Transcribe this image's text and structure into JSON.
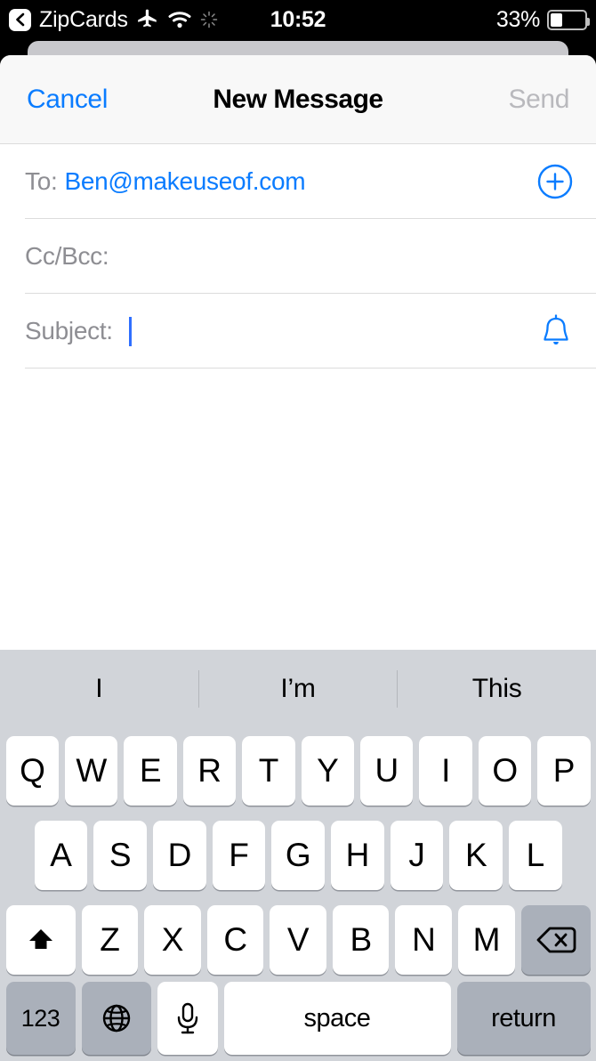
{
  "status_bar": {
    "back_icon": "chevron-left-icon",
    "app_name": "ZipCards",
    "airplane_icon": "airplane-mode-icon",
    "wifi_icon": "wifi-icon",
    "activity_icon": "activity-spinner-icon",
    "time": "10:52",
    "battery_percent": "33%",
    "battery_level": 33
  },
  "nav_bar": {
    "cancel_label": "Cancel",
    "title": "New Message",
    "send_label": "Send",
    "cancel_color": "#0a7cff",
    "send_color": "#b9b9bd"
  },
  "fields": [
    {
      "label": "To:",
      "value": "Ben@makeuseof.com",
      "action_icon": "add-contact-plus-circle-icon",
      "caret": false
    },
    {
      "label": "Cc/Bcc:",
      "value": "",
      "action_icon": "",
      "caret": false
    },
    {
      "label": "Subject:",
      "value": "",
      "action_icon": "notify-bell-icon",
      "caret": true
    }
  ],
  "body": {
    "text": ""
  },
  "keyboard": {
    "predictions": [
      "I",
      "I’m",
      "This"
    ],
    "row1": [
      "Q",
      "W",
      "E",
      "R",
      "T",
      "Y",
      "U",
      "I",
      "O",
      "P"
    ],
    "row2": [
      "A",
      "S",
      "D",
      "F",
      "G",
      "H",
      "J",
      "K",
      "L"
    ],
    "row3_letters": [
      "Z",
      "X",
      "C",
      "V",
      "B",
      "N",
      "M"
    ],
    "shift_icon": "shift-up-arrow-icon",
    "backspace_icon": "backspace-delete-icon",
    "numbers_label": "123",
    "globe_icon": "globe-language-icon",
    "mic_icon": "microphone-icon",
    "space_label": "space",
    "return_label": "return"
  },
  "colors": {
    "accent_blue": "#0a7cff",
    "keyboard_bg": "#d1d4d9",
    "key_white": "#ffffff",
    "key_grey": "#aab0ba",
    "nav_bg": "#f8f8f8",
    "label_grey": "#8e8e93"
  }
}
